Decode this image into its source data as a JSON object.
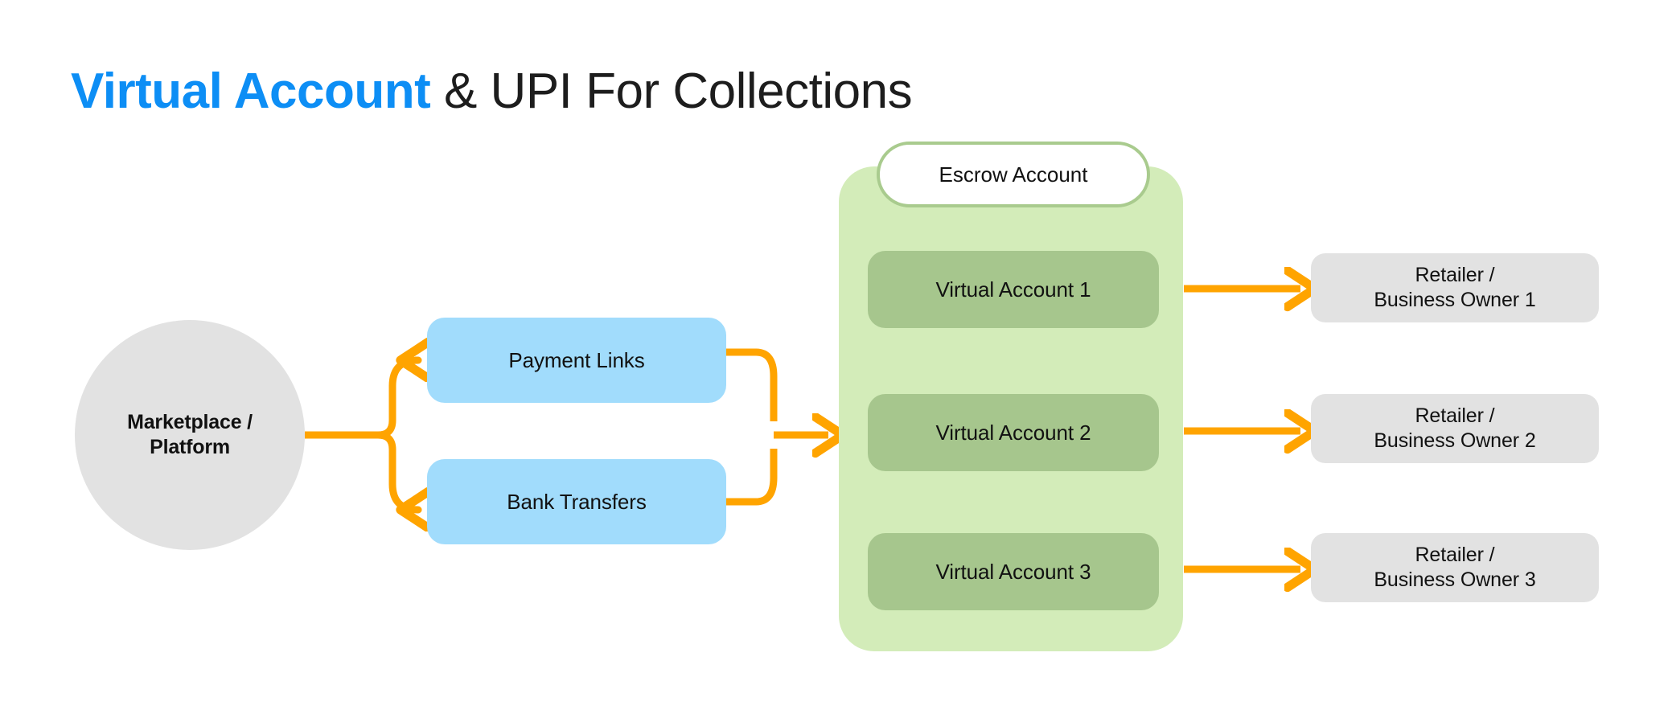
{
  "title": {
    "accent_text": "Virtual Account",
    "rest_text": " & UPI For Collections",
    "accent_color": "#0d8ef5",
    "text_color": "#1d1d1d"
  },
  "palette": {
    "background": "#ffffff",
    "arrow_orange": "#ffa400",
    "source_gray": "#e2e2e2",
    "channel_blue": "#a1dcfc",
    "escrow_container_green": "#d3ecb9",
    "escrow_border_green": "#a9cb8e",
    "virtual_account_green": "#a6c68d",
    "retailer_gray": "#e2e2e2"
  },
  "diagram": {
    "type": "flow-diagram",
    "source": {
      "name": "marketplace-platform",
      "shape": "circle",
      "label_line_1": "Marketplace /",
      "label_line_2": "Platform"
    },
    "channels": [
      {
        "name": "payment-links",
        "label": "Payment Links"
      },
      {
        "name": "bank-transfers",
        "label": "Bank Transfers"
      }
    ],
    "escrow": {
      "badge_label": "Escrow Account",
      "accounts": [
        {
          "name": "virtual-account-1",
          "label": "Virtual Account 1"
        },
        {
          "name": "virtual-account-2",
          "label": "Virtual Account 2"
        },
        {
          "name": "virtual-account-3",
          "label": "Virtual Account 3"
        }
      ]
    },
    "recipients": [
      {
        "name": "retailer-1",
        "label_line_1": "Retailer /",
        "label_line_2": "Business Owner 1"
      },
      {
        "name": "retailer-2",
        "label_line_1": "Retailer /",
        "label_line_2": "Business Owner 2"
      },
      {
        "name": "retailer-3",
        "label_line_1": "Retailer /",
        "label_line_2": "Business Owner 3"
      }
    ],
    "flows": [
      {
        "from": "marketplace-platform",
        "to": "payment-links"
      },
      {
        "from": "marketplace-platform",
        "to": "bank-transfers"
      },
      {
        "from": "payment-links",
        "to": "escrow-account"
      },
      {
        "from": "bank-transfers",
        "to": "escrow-account"
      },
      {
        "from": "virtual-account-1",
        "to": "retailer-1"
      },
      {
        "from": "virtual-account-2",
        "to": "retailer-2"
      },
      {
        "from": "virtual-account-3",
        "to": "retailer-3"
      }
    ]
  }
}
